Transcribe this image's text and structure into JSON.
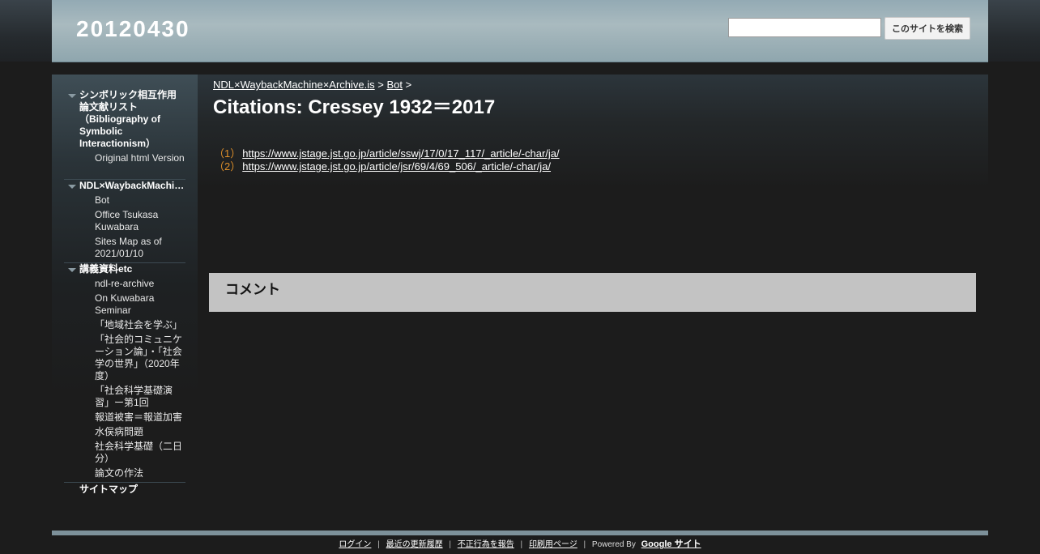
{
  "header": {
    "site_title": "20120430",
    "search_placeholder": "",
    "search_button_label": "このサイトを検索"
  },
  "sidebar": {
    "groups": [
      {
        "title": "シンボリック相互作用論文献リスト（Bibliography of Symbolic Interactionism）",
        "items": [
          "Original html Version"
        ]
      },
      {
        "title": "NDL×WaybackMachine×Archive.is",
        "items": [
          "Bot",
          "Office Tsukasa Kuwabara",
          "Sites Map as of 2021/01/10"
        ]
      },
      {
        "title": "講義資料etc",
        "items": [
          "ndl-re-archive",
          "On Kuwabara Seminar",
          "「地域社会を学ぶ」",
          "「社会的コミュニケーション論」・「社会学の世界」（2020年度）",
          "「社会科学基礎演習」ー第1回",
          "報道被害＝報道加害",
          "水俣病問題",
          "社会科学基礎（二日分）",
          "論文の作法"
        ]
      }
    ],
    "sitemap_label": "サイトマップ"
  },
  "breadcrumb": {
    "crumb1": "NDL×WaybackMachine×Archive.is",
    "sep1": ">",
    "crumb2": "Bot",
    "sep2": ">"
  },
  "page": {
    "title": "Citations: Cressey 1932＝2017",
    "citations": [
      {
        "num": "（1）",
        "url": "https://www.jstage.jst.go.jp/article/sswj/17/0/17_117/_article/-char/ja/"
      },
      {
        "num": "（2）",
        "url": "https://www.jstage.jst.go.jp/article/jsr/69/4/69_506/_article/-char/ja/"
      }
    ]
  },
  "comments": {
    "title": "コメント"
  },
  "footer": {
    "login": "ログイン",
    "recent_activity": "最近の更新履歴",
    "report_abuse": "不正行為を報告",
    "print_page": "印刷用ページ",
    "powered_by": "Powered By",
    "google_sites": "Google サイト",
    "separator": "|"
  }
}
